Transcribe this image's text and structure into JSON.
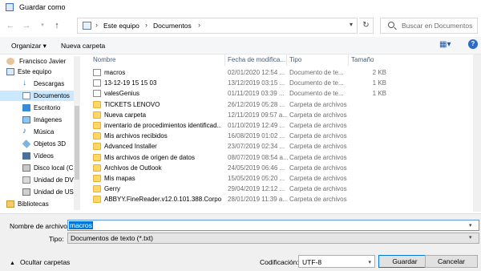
{
  "window": {
    "title": "Guardar como"
  },
  "address": {
    "crumbs": [
      "Este equipo",
      "Documentos"
    ]
  },
  "search": {
    "placeholder": "Buscar en Documentos"
  },
  "toolbar": {
    "organize": "Organizar ▾",
    "new_folder": "Nueva carpeta"
  },
  "sidebar": {
    "items": [
      {
        "label": "Francisco Javier",
        "icon": "user-icon"
      },
      {
        "label": "Este equipo",
        "icon": "computer-icon"
      },
      {
        "label": "Descargas",
        "icon": "download-icon"
      },
      {
        "label": "Documentos",
        "icon": "documents-icon"
      },
      {
        "label": "Escritorio",
        "icon": "desktop-icon"
      },
      {
        "label": "Imágenes",
        "icon": "pictures-icon"
      },
      {
        "label": "Música",
        "icon": "music-icon"
      },
      {
        "label": "Objetos 3D",
        "icon": "3d-objects-icon"
      },
      {
        "label": "Vídeos",
        "icon": "videos-icon"
      },
      {
        "label": "Disco local (C:)",
        "icon": "disk-icon"
      },
      {
        "label": "Unidad de DVD",
        "icon": "dvd-icon"
      },
      {
        "label": "Unidad de USB",
        "icon": "usb-icon"
      },
      {
        "label": "Bibliotecas",
        "icon": "library-icon"
      }
    ]
  },
  "columns": {
    "name": "Nombre",
    "date": "Fecha de modifica...",
    "type": "Tipo",
    "size": "Tamaño"
  },
  "files": [
    {
      "name": "macros",
      "date": "02/01/2020 12:54 ...",
      "type": "Documento de te...",
      "size": "2 KB",
      "kind": "file"
    },
    {
      "name": "13-12-19 15 15 03",
      "date": "13/12/2019 03:15 ...",
      "type": "Documento de te...",
      "size": "1 KB",
      "kind": "file"
    },
    {
      "name": "valesGenius",
      "date": "01/11/2019 03:39 ...",
      "type": "Documento de te...",
      "size": "1 KB",
      "kind": "file"
    },
    {
      "name": "TICKETS LENOVO",
      "date": "26/12/2019 05:28 ...",
      "type": "Carpeta de archivos",
      "size": "",
      "kind": "folder"
    },
    {
      "name": "Nueva carpeta",
      "date": "12/11/2019 09:57 a...",
      "type": "Carpeta de archivos",
      "size": "",
      "kind": "folder"
    },
    {
      "name": "inventario de procedimientos identificad...",
      "date": "01/10/2019 12:49 ...",
      "type": "Carpeta de archivos",
      "size": "",
      "kind": "folder"
    },
    {
      "name": "Mis archivos recibidos",
      "date": "16/08/2019 01:02 ...",
      "type": "Carpeta de archivos",
      "size": "",
      "kind": "folder"
    },
    {
      "name": "Advanced Installer",
      "date": "23/07/2019 02:34 ...",
      "type": "Carpeta de archivos",
      "size": "",
      "kind": "folder"
    },
    {
      "name": "Mis archivos de origen de datos",
      "date": "08/07/2019 08:54 a...",
      "type": "Carpeta de archivos",
      "size": "",
      "kind": "folder"
    },
    {
      "name": "Archivos de Outlook",
      "date": "24/05/2019 06:46 ...",
      "type": "Carpeta de archivos",
      "size": "",
      "kind": "folder"
    },
    {
      "name": "Mis mapas",
      "date": "15/05/2019 05:20 ...",
      "type": "Carpeta de archivos",
      "size": "",
      "kind": "folder"
    },
    {
      "name": "Gerry",
      "date": "29/04/2019 12:12 ...",
      "type": "Carpeta de archivos",
      "size": "",
      "kind": "folder"
    },
    {
      "name": "ABBYY.FineReader.v12.0.101.388.Corpora...",
      "date": "28/01/2019 11:39 a...",
      "type": "Carpeta de archivos",
      "size": "",
      "kind": "folder"
    }
  ],
  "filename": {
    "label": "Nombre de archivo:",
    "value": "macros"
  },
  "filetype": {
    "label": "Tipo:",
    "value": "Documentos de texto (*.txt)"
  },
  "footer": {
    "hide_folders": "Ocultar carpetas",
    "encoding_label": "Codificación:",
    "encoding_value": "UTF-8",
    "save": "Guardar",
    "cancel": "Cancelar"
  },
  "colors": {
    "selection": "#cce8ff",
    "accent": "#0078d7",
    "folder": "#ffd766"
  }
}
